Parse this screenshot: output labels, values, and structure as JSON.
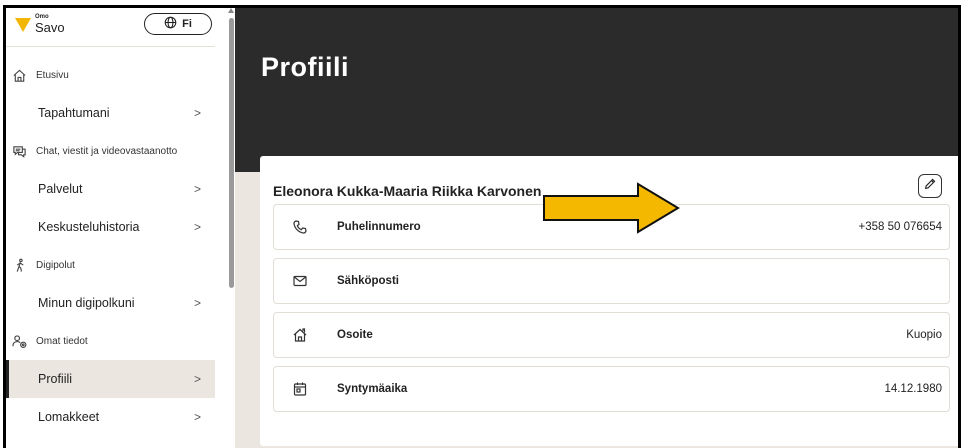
{
  "logo": {
    "small": "Omo",
    "big": "Savo"
  },
  "language_button": {
    "label": "Fi"
  },
  "sidebar": {
    "entries": [
      {
        "kind": "section",
        "icon": "home-icon",
        "label": "Etusivu"
      },
      {
        "kind": "item",
        "label": "Tapahtumani"
      },
      {
        "kind": "section",
        "icon": "chat-icon",
        "label": "Chat, viestit ja videovastaanotto"
      },
      {
        "kind": "item",
        "label": "Palvelut"
      },
      {
        "kind": "item",
        "label": "Keskusteluhistoria"
      },
      {
        "kind": "section",
        "icon": "walking-person-icon",
        "label": "Digipolut"
      },
      {
        "kind": "item",
        "label": "Minun digipolkuni"
      },
      {
        "kind": "section",
        "icon": "user-settings-icon",
        "label": "Omat tiedot"
      },
      {
        "kind": "item",
        "label": "Profiili",
        "active": true
      },
      {
        "kind": "item",
        "label": "Lomakkeet"
      }
    ],
    "chevron": ">"
  },
  "page": {
    "title": "Profiili",
    "name": "Eleonora Kukka-Maaria Riikka Karvonen",
    "fields": [
      {
        "icon": "phone-icon",
        "label": "Puhelinnumero",
        "value": "+358 50 076654"
      },
      {
        "icon": "mail-icon",
        "label": "Sähköposti",
        "value": ""
      },
      {
        "icon": "house-icon",
        "label": "Osoite",
        "value": "Kuopio"
      },
      {
        "icon": "calendar-icon",
        "label": "Syntymäaika",
        "value": "14.12.1980"
      }
    ]
  },
  "colors": {
    "accent_yellow": "#f2b705",
    "hero_bg": "#2b2b2b",
    "page_bg": "#ebe6df",
    "active_item_bg": "#ebe6df"
  }
}
